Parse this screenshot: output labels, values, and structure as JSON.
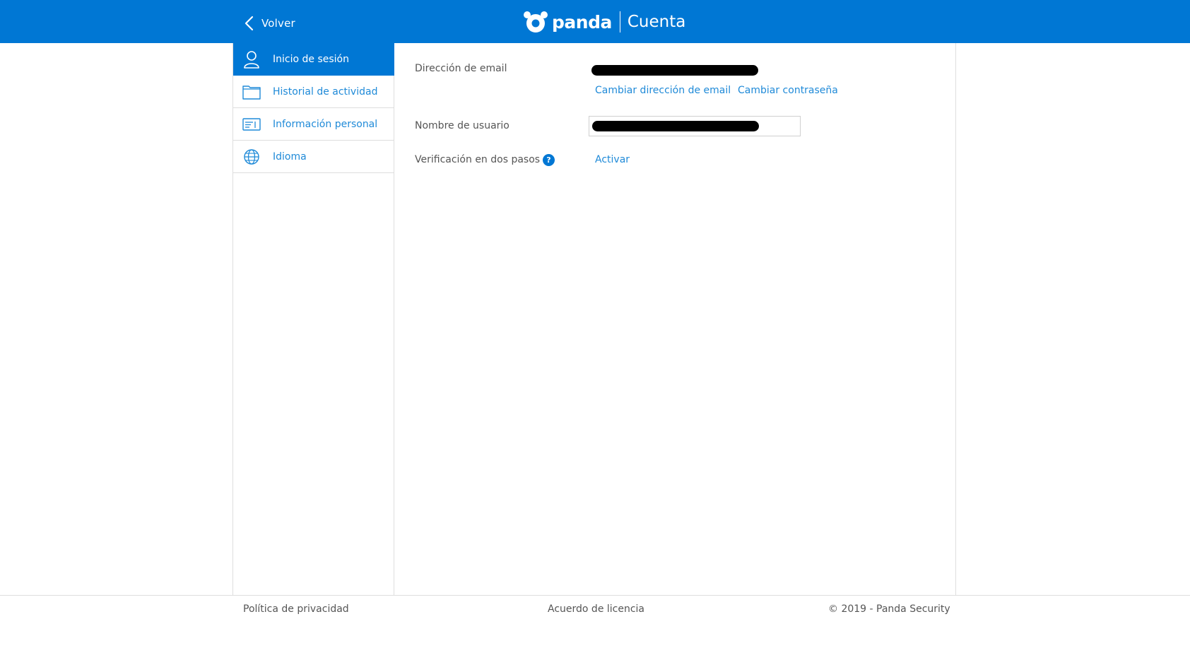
{
  "header": {
    "back_label": "Volver",
    "brand_name": "panda",
    "brand_sub": "Cuenta"
  },
  "sidebar": {
    "items": [
      {
        "label": "Inicio de sesión",
        "icon": "user-icon",
        "active": true
      },
      {
        "label": "Historial de actividad",
        "icon": "folder-icon",
        "active": false
      },
      {
        "label": "Información personal",
        "icon": "id-card-icon",
        "active": false
      },
      {
        "label": "Idioma",
        "icon": "globe-icon",
        "active": false
      }
    ]
  },
  "main": {
    "email_label": "Dirección de email",
    "change_email_link": "Cambiar dirección de email",
    "change_password_link": "Cambiar contraseña",
    "username_label": "Nombre de usuario",
    "two_step_label": "Verificación en dos pasos",
    "help_symbol": "?",
    "activate_link": "Activar"
  },
  "footer": {
    "privacy": "Política de privacidad",
    "license": "Acuerdo de licencia",
    "copyright": "© 2019 - Panda Security"
  },
  "colors": {
    "accent": "#0077d4",
    "link": "#1f8ad8",
    "text": "#555555",
    "border": "#dedede"
  }
}
